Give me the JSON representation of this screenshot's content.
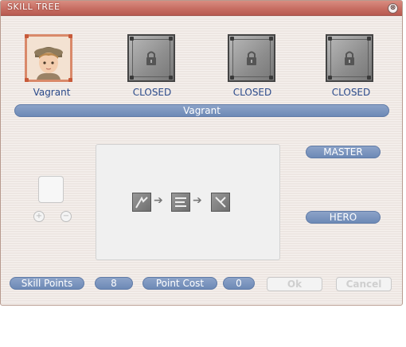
{
  "window": {
    "title": "SKILL TREE",
    "close_glyph": "⊗"
  },
  "jobs": [
    {
      "label": "Vagrant",
      "icon": "vagrant-portrait"
    },
    {
      "label": "CLOSED",
      "icon": "lock-icon"
    },
    {
      "label": "CLOSED",
      "icon": "lock-icon"
    },
    {
      "label": "CLOSED",
      "icon": "lock-icon"
    }
  ],
  "selected_job_bar": "Vagrant",
  "right_labels": {
    "master": "MASTER",
    "hero": "HERO"
  },
  "skill_chain": [
    "skill-1-icon",
    "skill-2-icon",
    "skill-3-icon"
  ],
  "controls": {
    "plus": "+",
    "minus": "−"
  },
  "footer": {
    "skill_points_label": "Skill Points",
    "skill_points_value": "8",
    "point_cost_label": "Point Cost",
    "point_cost_value": "0",
    "ok_label": "Ok",
    "cancel_label": "Cancel"
  }
}
